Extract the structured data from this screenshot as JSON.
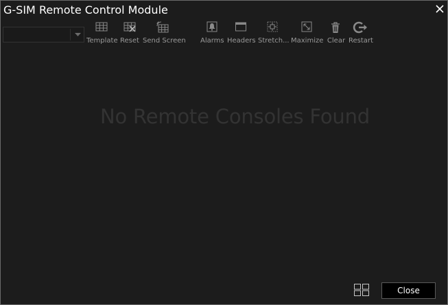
{
  "window": {
    "title": "G-SIM Remote Control Module"
  },
  "console_select": {
    "value": ""
  },
  "toolbar": {
    "template": "Template",
    "reset": "Reset",
    "send_screen": "Send Screen",
    "alarms": "Alarms",
    "headers": "Headers",
    "stretch": "Stretch...",
    "maximize": "Maximize",
    "clear": "Clear",
    "restart": "Restart"
  },
  "main": {
    "empty_message": "No Remote Consoles Found"
  },
  "footer": {
    "close_label": "Close"
  },
  "colors": {
    "background": "#1c1c1c",
    "border": "#6a6a6a",
    "icon": "#8a8a8a",
    "text": "#ffffff"
  },
  "icons": [
    "close-icon",
    "template-grid-icon",
    "reset-icon",
    "send-screen-icon",
    "alarm-bell-icon",
    "header-window-icon",
    "stretch-icon",
    "maximize-icon",
    "trash-icon",
    "restart-icon",
    "layout-grid-icon",
    "chevron-down-icon"
  ]
}
